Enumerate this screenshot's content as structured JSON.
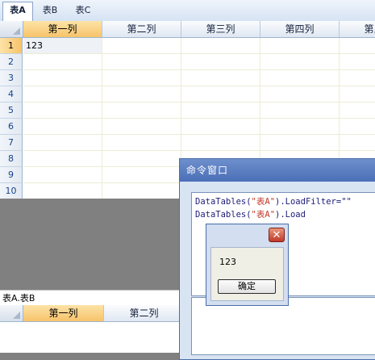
{
  "tabs": [
    {
      "label": "表A",
      "active": true
    },
    {
      "label": "表B",
      "active": false
    },
    {
      "label": "表C",
      "active": false
    }
  ],
  "main_grid": {
    "columns": [
      "第一列",
      "第二列",
      "第三列",
      "第四列",
      "第五列"
    ],
    "rows": [
      "1",
      "2",
      "3",
      "4",
      "5",
      "6",
      "7",
      "8",
      "9",
      "10"
    ],
    "cells": {
      "r1c1": "123"
    }
  },
  "sub_table_label": "表A.表B",
  "sub_grid": {
    "columns": [
      "第一列",
      "第二列"
    ]
  },
  "command_window": {
    "title": "命令窗口",
    "code_lines": [
      {
        "pre": "DataTables(",
        "str": "\"表A\"",
        "post": ").LoadFilter=\"\""
      },
      {
        "pre": "DataTables(",
        "str": "\"表A\"",
        "post": ").Load"
      }
    ]
  },
  "message_box": {
    "close_glyph": "✕",
    "text": "123",
    "ok_label": "确定"
  },
  "colors": {
    "selected_header": "#f7c36a",
    "title_bar": "#4b6fb6",
    "workspace": "#808080"
  }
}
